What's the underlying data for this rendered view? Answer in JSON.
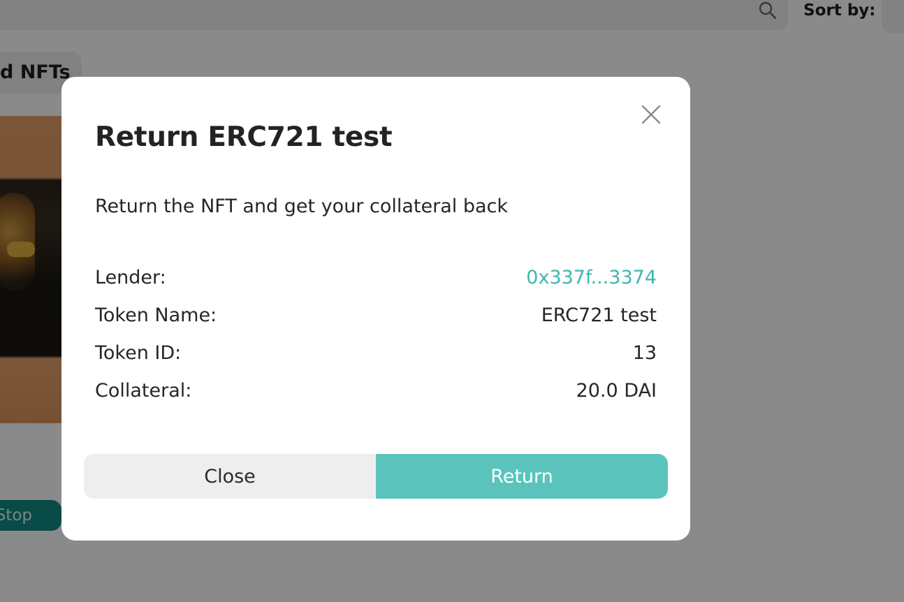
{
  "background": {
    "sort_label": "Sort by:",
    "section_label": "d NFTs",
    "stop_button_label": "Stop"
  },
  "modal": {
    "title": "Return ERC721 test",
    "subtitle": "Return the NFT and get your collateral back",
    "details": [
      {
        "label": "Lender:",
        "value": "0x337f...3374"
      },
      {
        "label": "Token Name:",
        "value": "ERC721 test"
      },
      {
        "label": "Token ID:",
        "value": "13"
      },
      {
        "label": "Collateral:",
        "value": "20.0 DAI"
      }
    ],
    "close_label": "Close",
    "return_label": "Return"
  },
  "colors": {
    "accent": "#5ac4bc",
    "link": "#3bb8ad",
    "overlay": "rgba(0,0,0,0.46)"
  },
  "icons": {
    "search": "search-icon",
    "close": "close-icon"
  }
}
